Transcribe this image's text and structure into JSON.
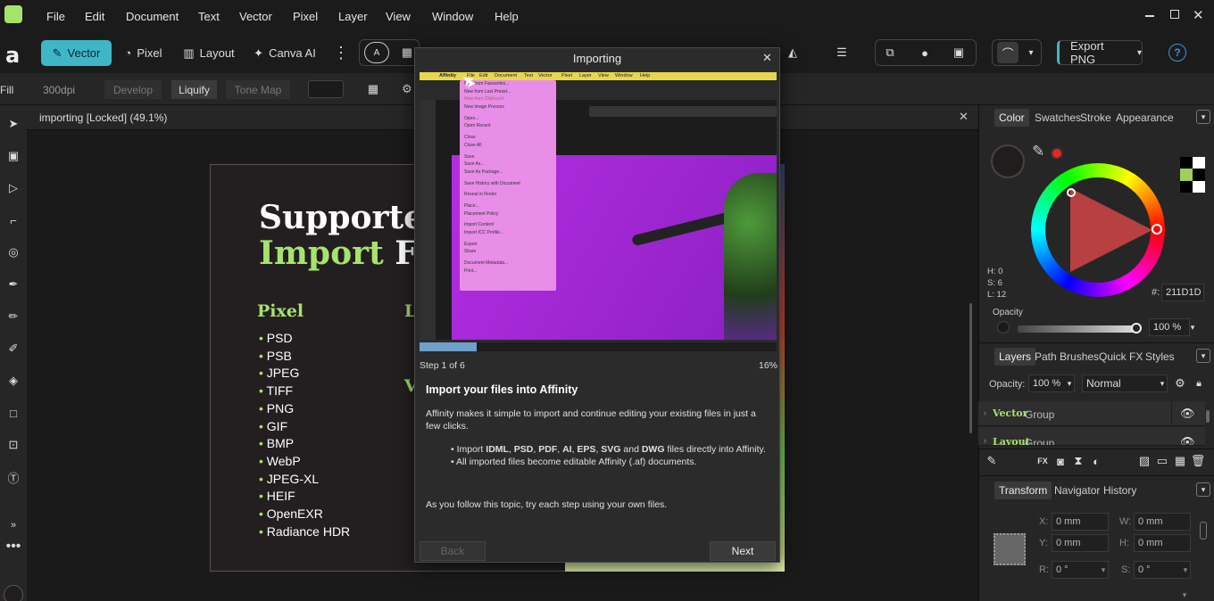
{
  "menu": {
    "items": [
      "File",
      "Edit",
      "Document",
      "Text",
      "Vector",
      "Pixel",
      "Layer",
      "View",
      "Window",
      "Help"
    ]
  },
  "toolbar": {
    "personas": [
      "Vector",
      "Pixel",
      "Layout",
      "Canva AI"
    ],
    "export_label": "Export PNG",
    "help_label": "?"
  },
  "context": {
    "fill_label": "Fill",
    "dpi": "300dpi",
    "develop": "Develop",
    "liquify": "Liquify",
    "tone_map": "Tone Map"
  },
  "document": {
    "tab_title": "importing [Locked] (49.1%)",
    "title_line1": "Supportec",
    "title_line2_green": "Import",
    "title_line2_white": " Fo",
    "col_heading": "Pixel",
    "col2_heading_l": "L",
    "col2_heading_v": "V",
    "formats": [
      "PSD",
      "PSB",
      "JPEG",
      "TIFF",
      "PNG",
      "GIF",
      "BMP",
      "WebP",
      "JPEG-XL",
      "HEIF",
      "OpenEXR",
      "Radiance HDR"
    ]
  },
  "dialog": {
    "title": "Importing",
    "step": "Step 1 of 6",
    "percent": "16%",
    "progress": 0.16,
    "heading": "Import your files into Affinity",
    "intro": "Affinity makes it simple to import and continue editing your existing files in just a few clicks.",
    "bullet1": "Import IDML, PSD, PDF, AI, EPS, SVG and DWG files directly into Affinity.",
    "bullet2": "All imported files become editable Affinity (.af) documents.",
    "outro": "As you follow this topic, try each step using your own files.",
    "back_label": "Back",
    "next_label": "Next",
    "shot_menu": [
      "Affinity",
      "File",
      "Edit",
      "Document",
      "Text",
      "Vector",
      "Pixel",
      "Layer",
      "View",
      "Window",
      "Help"
    ],
    "shot_dropdown": [
      "New from Favourites...",
      "New from Last Preset...",
      "New from Clipboard",
      "New Image Process",
      "Open...",
      "Open Recent",
      "Close",
      "Close All",
      "Save",
      "Save As...",
      "Save As Package...",
      "Save History with Document",
      "Reveal in Finder",
      "Place...",
      "Placement Policy",
      "Import Content",
      "Import ICC Profile...",
      "Export",
      "Share",
      "Document Metadata...",
      "Print..."
    ]
  },
  "right": {
    "color_tabs": [
      "Color",
      "Swatches",
      "Stroke",
      "Appearance"
    ],
    "hsl": {
      "h": "H: 0",
      "s": "S: 6",
      "l": "L: 12"
    },
    "hex_label": "#:",
    "hex": "211D1D",
    "opacity_label": "Opacity",
    "opacity_value": "100 %",
    "layer_tabs": [
      "Layers",
      "Path Brushes",
      "Quick FX",
      "Styles"
    ],
    "layer_opacity_label": "Opacity:",
    "layer_opacity": "100 %",
    "blend_mode": "Normal",
    "layers": [
      {
        "type": "Vector",
        "name": "Group"
      },
      {
        "type": "Layout",
        "name": "Group"
      }
    ],
    "transform_tabs": [
      "Transform",
      "Navigator",
      "History"
    ],
    "transform": {
      "x_label": "X:",
      "x": "0 mm",
      "y_label": "Y:",
      "y": "0 mm",
      "w_label": "W:",
      "w": "0 mm",
      "h_label": "H:",
      "h": "0 mm",
      "r_label": "R:",
      "r": "0 °",
      "s_label": "S:",
      "s": "0 °"
    }
  },
  "colors": {
    "accent": "#3fb6c6",
    "doc_green": "#a6e36c",
    "primary_swatch": "#211D1D"
  }
}
